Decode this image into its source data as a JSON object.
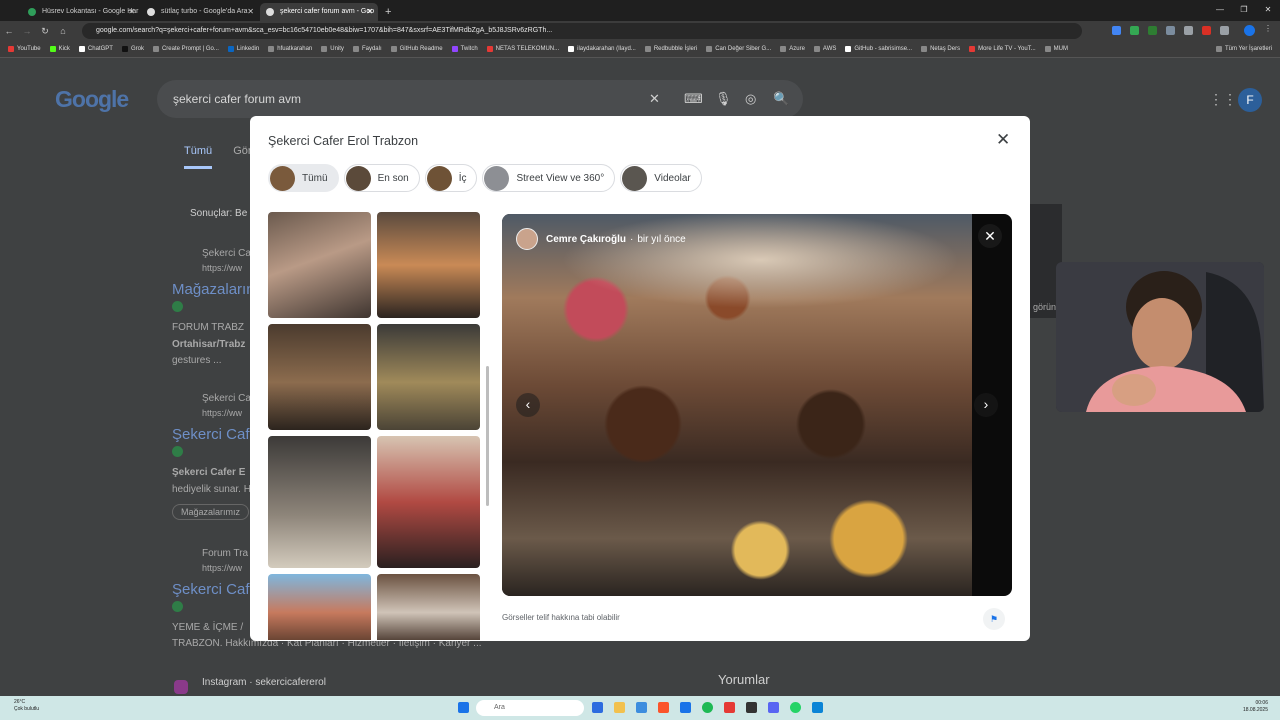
{
  "browser": {
    "tabs": [
      {
        "title": "Hüsrev Lokantası - Google Har",
        "active": false
      },
      {
        "title": "sütlaç turbo - Google'da Ara",
        "active": false
      },
      {
        "title": "şekerci cafer forum avm - Goo",
        "active": true
      }
    ],
    "new_tab": "+",
    "url": "google.com/search?q=şekerci+cafer+forum+avm&sca_esv=bc16c54710eb0e48&biw=1707&bih=847&sxsrf=AE3TifMRdbZgA_b5J8JSRv6zRGTh...",
    "bookmarks": [
      "YouTube",
      "Kick",
      "ChatGPT",
      "Grok",
      "Create Prompt | Go...",
      "Linkedin",
      "hfuatkarahan",
      "Unity",
      "Faydalı",
      "GitHub Readme",
      "Twitch",
      "NETAS TELEKOMUN...",
      "ilaydakarahan (Ilayd...",
      "Redbubble İşleri",
      "Can Değer Siber G...",
      "Azure",
      "AWS",
      "GitHub - sabrisimse...",
      "Netaş Ders",
      "More Life TV - YouT...",
      "MUM",
      "Tüm Yer İşaretleri"
    ]
  },
  "google": {
    "logo": "Google",
    "query": "şekerci cafer forum avm",
    "tabs": [
      "Tümü",
      "Görs"
    ],
    "avatar": "F",
    "results_header": "Sonuçlar: Be",
    "bg_results": [
      {
        "site": "Şekerci Ca",
        "url": "https://ww",
        "title": "Mağazaların",
        "snippet1": "FORUM TRABZ",
        "snippet2": "Ortahisar/Trabz",
        "snippet3": "gestures ..."
      },
      {
        "site": "Şekerci Ca",
        "url": "https://ww",
        "title": "Şekerci Caf",
        "snippet1": "Şekerci Cafer E",
        "snippet2": "hediyelik sunar. H",
        "chip": "Mağazalarımız"
      },
      {
        "site": "Forum Tra",
        "url": "https://ww",
        "title": "Şekerci Caf",
        "snippet1": "YEME & İÇME /",
        "snippet2": "TRABZON. Hakkımızda · Kat Planları · Hizmetler · İletişim · Kariyer ..."
      },
      {
        "site": "Instagram · sekercicafererol",
        "url": "",
        "title": "",
        "snippet1": ""
      }
    ],
    "right_label": "görün",
    "reviews_heading": "Yorumlar"
  },
  "modal": {
    "title": "Şekerci Cafer Erol Trabzon",
    "close": "✕",
    "filter_chips": [
      "Tümü",
      "En son",
      "İç",
      "Street View ve 360°",
      "Videolar"
    ],
    "selected_chip": "Tümü",
    "author": "Cemre Çakıroğlu",
    "time": "bir yıl önce",
    "separator": "·",
    "copyright_note": "Görseller telif hakkına tabi olabilir"
  },
  "taskbar": {
    "weather_temp": "26°C",
    "weather_desc": "Çok bulutlu",
    "search_placeholder": "Ara",
    "time": "00:06",
    "date": "18.08.2025"
  }
}
